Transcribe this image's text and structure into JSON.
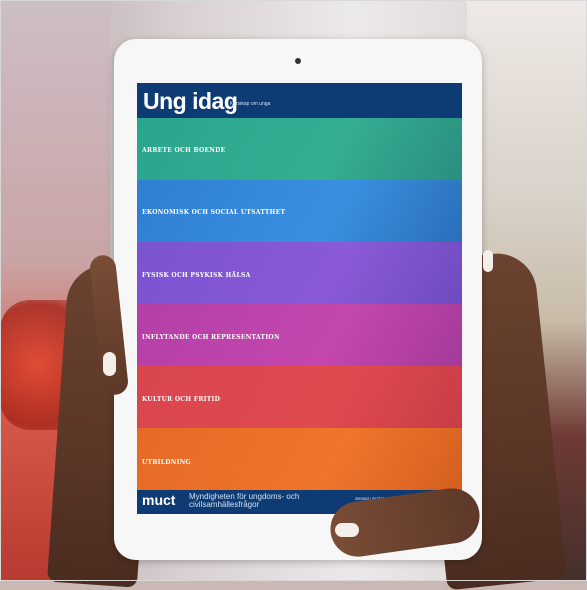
{
  "app": {
    "logo": "Ung idag",
    "tagline": "Kunskap om unga"
  },
  "menu": {
    "items": [
      {
        "label": "ARBETE OCH BOENDE",
        "color": "#2aa58d"
      },
      {
        "label": "EKONOMISK OCH SOCIAL UTSATTHET",
        "color": "#2f7fd3"
      },
      {
        "label": "FYSISK OCH PSYKISK HÄLSA",
        "color": "#7a53d0"
      },
      {
        "label": "INFLYTANDE OCH REPRESENTATION",
        "color": "#b43fa8"
      },
      {
        "label": "KULTUR OCH FRITID",
        "color": "#d9464e"
      },
      {
        "label": "UTBILDNING",
        "color": "#e66a25"
      }
    ]
  },
  "footer": {
    "brand": "muct",
    "agency": "Myndigheten för ungdoms- och civilsamhällesfrågor",
    "right_text": "Senast uppdaterad"
  },
  "colors": {
    "header_bg": "#0f3b74"
  }
}
